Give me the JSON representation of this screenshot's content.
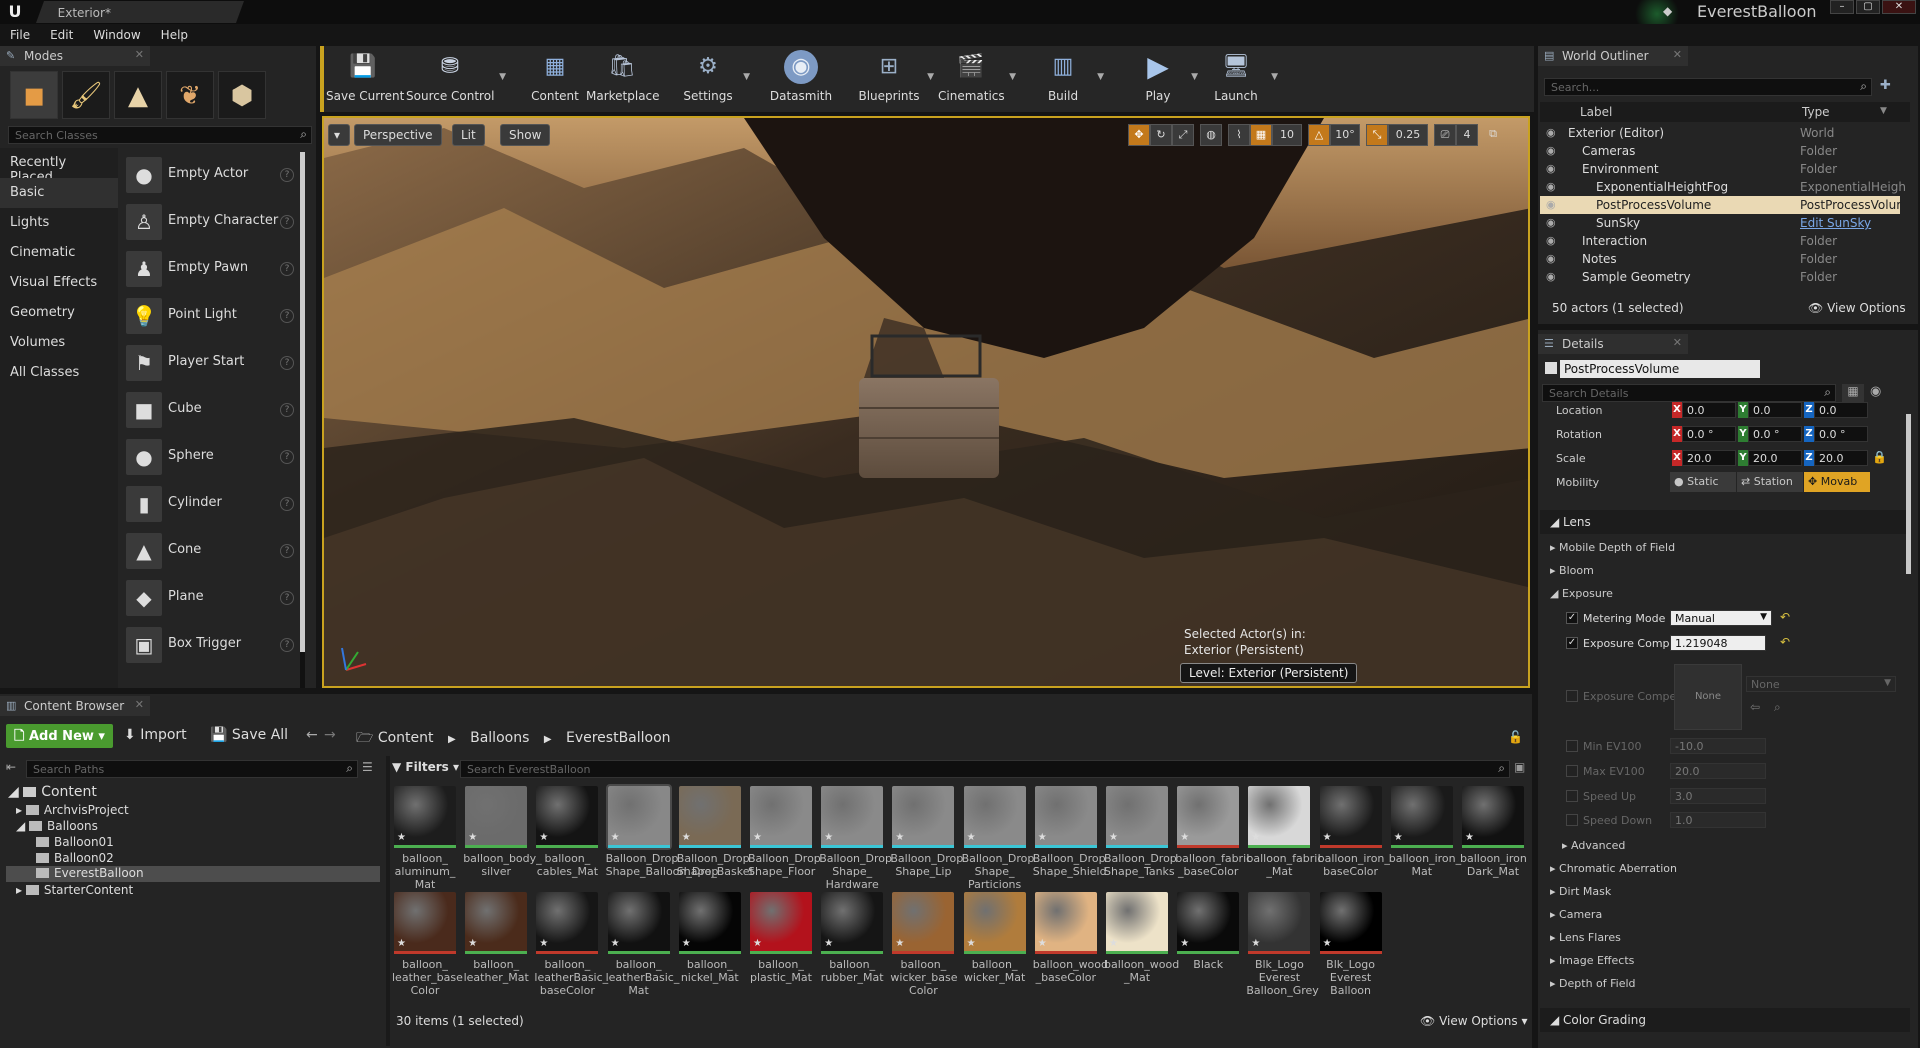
{
  "titlebar": {
    "doc_tab": "Exterior*",
    "project": "EverestBalloon"
  },
  "menu": [
    "File",
    "Edit",
    "Window",
    "Help"
  ],
  "modes": {
    "title": "Modes",
    "search_placeholder": "Search Classes",
    "categories": [
      "Recently Placed",
      "Basic",
      "Lights",
      "Cinematic",
      "Visual Effects",
      "Geometry",
      "Volumes",
      "All Classes"
    ],
    "items": [
      "Empty Actor",
      "Empty Character",
      "Empty Pawn",
      "Point Light",
      "Player Start",
      "Cube",
      "Sphere",
      "Cylinder",
      "Cone",
      "Plane",
      "Box Trigger"
    ]
  },
  "toolbar": [
    "Save Current",
    "Source Control",
    "Content",
    "Marketplace",
    "Settings",
    "Datasmith",
    "Blueprints",
    "Cinematics",
    "Build",
    "Play",
    "Launch"
  ],
  "viewport": {
    "perspective": "Perspective",
    "lit": "Lit",
    "show": "Show",
    "grid_snap": "10",
    "rot_snap": "10°",
    "scale_snap": "0.25",
    "cam_speed": "4",
    "selected_line1": "Selected Actor(s) in:",
    "selected_line2": "Exterior (Persistent)",
    "level": "Level:  Exterior (Persistent)"
  },
  "outliner": {
    "title": "World Outliner",
    "search_placeholder": "Search...",
    "col_label": "Label",
    "col_type": "Type",
    "rows": [
      {
        "label": "Exterior (Editor)",
        "type": "World"
      },
      {
        "label": "Cameras",
        "type": "Folder"
      },
      {
        "label": "Environment",
        "type": "Folder"
      },
      {
        "label": "ExponentialHeightFog",
        "type": "ExponentialHeigh"
      },
      {
        "label": "PostProcessVolume",
        "type": "PostProcessVolur"
      },
      {
        "label": "SunSky",
        "type": "Edit SunSky"
      },
      {
        "label": "Interaction",
        "type": "Folder"
      },
      {
        "label": "Notes",
        "type": "Folder"
      },
      {
        "label": "Sample Geometry",
        "type": "Folder"
      }
    ],
    "status": "50 actors (1 selected)",
    "view_options": "View Options"
  },
  "details": {
    "title": "Details",
    "name": "PostProcessVolume",
    "search_placeholder": "Search Details",
    "location": {
      "label": "Location",
      "x": "0.0",
      "y": "0.0",
      "z": "0.0"
    },
    "rotation": {
      "label": "Rotation",
      "x": "0.0 °",
      "y": "0.0 °",
      "z": "0.0 °"
    },
    "scale": {
      "label": "Scale",
      "x": "20.0",
      "y": "20.0",
      "z": "20.0"
    },
    "mobility": {
      "label": "Mobility",
      "opts": [
        "Static",
        "Station",
        "Movab"
      ]
    },
    "lens": "Lens",
    "sections1": [
      "Mobile Depth of Field",
      "Bloom",
      "Exposure"
    ],
    "metering_label": "Metering Mode",
    "metering_value": "Manual",
    "expcomp_label": "Exposure Compe",
    "expcomp_value": "1.219048",
    "expcurve_label": "Exposure Compe",
    "none_thumb": "None",
    "none_dd": "None",
    "min_ev": {
      "label": "Min EV100",
      "value": "-10.0"
    },
    "max_ev": {
      "label": "Max EV100",
      "value": "20.0"
    },
    "speed_up": {
      "label": "Speed Up",
      "value": "3.0"
    },
    "speed_down": {
      "label": "Speed Down",
      "value": "1.0"
    },
    "advanced": "Advanced",
    "sections2": [
      "Chromatic Aberration",
      "Dirt Mask",
      "Camera",
      "Lens Flares",
      "Image Effects",
      "Depth of Field"
    ],
    "color_grading": "Color Grading"
  },
  "content_browser": {
    "title": "Content Browser",
    "add_new": "Add New",
    "import": "Import",
    "save_all": "Save All",
    "path": [
      "Content",
      "Balloons",
      "EverestBalloon"
    ],
    "search_paths": "Search Paths",
    "filters": "Filters",
    "search_assets": "Search EverestBalloon",
    "tree": [
      "Content",
      "ArchvisProject",
      "Balloons",
      "Balloon01",
      "Balloon02",
      "EverestBalloon",
      "StarterContent"
    ],
    "row1": [
      {
        "l": "balloon_ aluminum_ Mat",
        "c": "#1d1d1d",
        "b": "#4caf50"
      },
      {
        "l": "balloon_body_ silver",
        "c": "#6b6b6b",
        "b": "#4caf50"
      },
      {
        "l": "balloon_ cables_Mat",
        "c": "#141414",
        "b": "#4caf50"
      },
      {
        "l": "Balloon_Drop Shape_Balloon_Drop",
        "c": "#888888",
        "b": "#3bc6d6"
      },
      {
        "l": "Balloon_Drop Shape_Basket",
        "c": "#7a6a55",
        "b": "#3bc6d6"
      },
      {
        "l": "Balloon_Drop Shape_Floor",
        "c": "#8a8a8a",
        "b": "#3bc6d6"
      },
      {
        "l": "Balloon_Drop Shape_ Hardware",
        "c": "#8a8a8a",
        "b": "#3bc6d6"
      },
      {
        "l": "Balloon_Drop Shape_Lip",
        "c": "#8a8a8a",
        "b": "#3bc6d6"
      },
      {
        "l": "Balloon_Drop Shape_ Particions",
        "c": "#8a8a8a",
        "b": "#3bc6d6"
      },
      {
        "l": "Balloon_Drop Shape_Shield",
        "c": "#8a8a8a",
        "b": "#3bc6d6"
      },
      {
        "l": "Balloon_Drop Shape_Tanks",
        "c": "#8a8a8a",
        "b": "#3bc6d6"
      },
      {
        "l": "balloon_fabric _baseColor",
        "c": "#9a9a9a",
        "b": "#c0392b"
      },
      {
        "l": "balloon_fabric _Mat",
        "c": "#d8d8d8",
        "b": "#4caf50"
      },
      {
        "l": "balloon_iron_ baseColor",
        "c": "#1a1a1a",
        "b": "#c0392b"
      },
      {
        "l": "balloon_iron_ Mat",
        "c": "#1a1a1a",
        "b": "#4caf50"
      },
      {
        "l": "balloon_iron Dark_Mat",
        "c": "#111111",
        "b": "#4caf50"
      }
    ],
    "row2": [
      {
        "l": "balloon_ leather_base Color",
        "c": "#4a2a1c",
        "b": "#c0392b"
      },
      {
        "l": "balloon_ leather_Mat",
        "c": "#4b2b1b",
        "b": "#4caf50"
      },
      {
        "l": "balloon_ leatherBasic_ baseColor",
        "c": "#161616",
        "b": "#c0392b"
      },
      {
        "l": "balloon_ leatherBasic_ Mat",
        "c": "#111111",
        "b": "#4caf50"
      },
      {
        "l": "balloon_ nickel_Mat",
        "c": "#050505",
        "b": "#4caf50"
      },
      {
        "l": "balloon_ plastic_Mat",
        "c": "#b3121c",
        "b": "#4caf50"
      },
      {
        "l": "balloon_ rubber_Mat",
        "c": "#151515",
        "b": "#4caf50"
      },
      {
        "l": "balloon_ wicker_base Color",
        "c": "#9a6432",
        "b": "#c0392b"
      },
      {
        "l": "balloon_ wicker_Mat",
        "c": "#b07c3c",
        "b": "#4caf50"
      },
      {
        "l": "balloon_wood _baseColor",
        "c": "#e0b382",
        "b": "#c0392b"
      },
      {
        "l": "balloon_wood _Mat",
        "c": "#ede2c8",
        "b": "#4caf50"
      },
      {
        "l": "Black",
        "c": "#0a0a0a",
        "b": "#4caf50"
      },
      {
        "l": "Blk_Logo Everest Balloon_Grey",
        "c": "#333333",
        "b": "#c0392b"
      },
      {
        "l": "Blk_Logo Everest Balloon",
        "c": "#000000",
        "b": "#c0392b"
      }
    ],
    "status": "30 items (1 selected)",
    "view_options": "View Options"
  }
}
